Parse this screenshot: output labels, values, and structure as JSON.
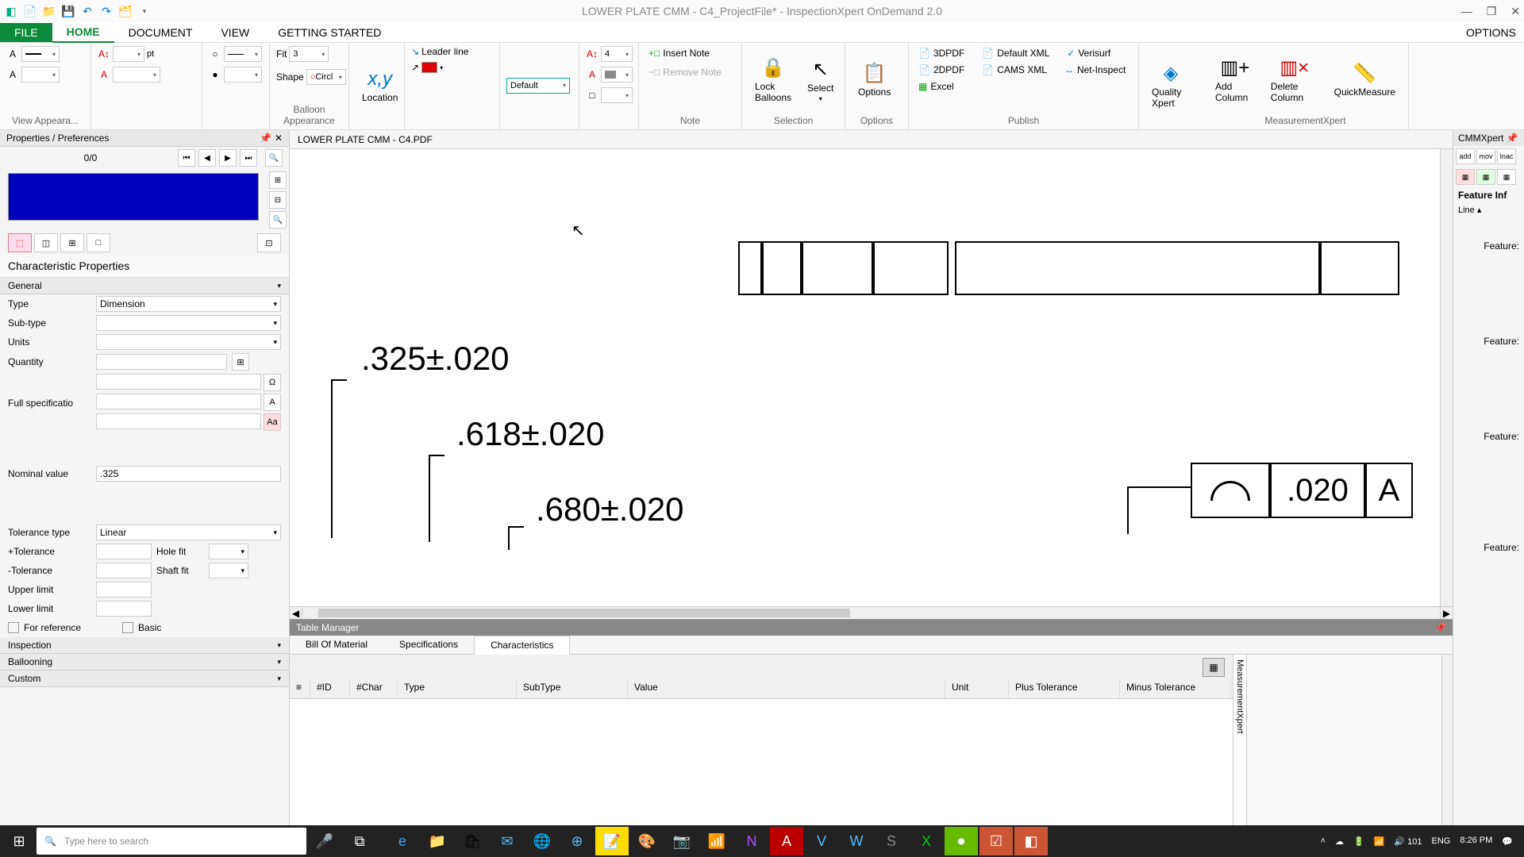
{
  "titlebar": {
    "title": "LOWER PLATE CMM - C4_ProjectFile* - InspectionXpert OnDemand 2.0"
  },
  "menu": {
    "file": "FILE",
    "home": "HOME",
    "document": "DOCUMENT",
    "view": "VIEW",
    "getting_started": "GETTING STARTED",
    "options": "OPTIONS"
  },
  "ribbon": {
    "view_appearance": "View Appeara...",
    "pt": "pt",
    "fit_label": "Fit",
    "shape_label": "Shape",
    "fit_value": "3",
    "shape_value": "Circl",
    "location": "Location",
    "balloon_appearance": "Balloon Appearance",
    "leader_line": "Leader line",
    "default": "Default",
    "note_size": "4",
    "insert_note": "Insert Note",
    "remove_note": "Remove Note",
    "note": "Note",
    "lock_balloons": "Lock Balloons",
    "select": "Select",
    "selection": "Selection",
    "options": "Options",
    "options_group": "Options",
    "pdf3d": "3DPDF",
    "pdf2d": "2DPDF",
    "excel": "Excel",
    "default_xml": "Default XML",
    "cams_xml": "CAMS XML",
    "verisurf": "Verisurf",
    "net_inspect": "Net-Inspect",
    "quality_xpert": "Quality Xpert",
    "publish": "Publish",
    "add_column": "Add Column",
    "delete_column": "Delete Column",
    "quick_measure": "QuickMeasure",
    "measurement_xpert": "MeasurementXpert"
  },
  "left_panel": {
    "title": "Properties / Preferences",
    "counter": "0/0",
    "char_props": "Characteristic Properties",
    "general": "General",
    "type": "Type",
    "type_value": "Dimension",
    "subtype": "Sub-type",
    "units": "Units",
    "quantity": "Quantity",
    "full_spec": "Full specificatio",
    "nominal": "Nominal value",
    "nominal_value": ".325",
    "tol_type": "Tolerance type",
    "tol_type_value": "Linear",
    "plus_tol": "+Tolerance",
    "minus_tol": "-Tolerance",
    "hole_fit": "Hole fit",
    "shaft_fit": "Shaft fit",
    "upper_limit": "Upper limit",
    "lower_limit": "Lower limit",
    "for_reference": "For reference",
    "basic": "Basic",
    "inspection": "Inspection",
    "ballooning": "Ballooning",
    "custom": "Custom"
  },
  "document": {
    "tab": "LOWER PLATE CMM - C4.PDF",
    "dims": {
      "d1": ".325±.020",
      "d2": ".618±.020",
      "d3": ".680±.020",
      "fcf_val": ".020",
      "fcf_datum": "A"
    }
  },
  "table_manager": {
    "title": "Table Manager",
    "tabs": {
      "bom": "Bill Of Material",
      "spec": "Specifications",
      "char": "Characteristics"
    },
    "cols": {
      "id": "#ID",
      "char": "#Char",
      "type": "Type",
      "subtype": "SubType",
      "value": "Value",
      "unit": "Unit",
      "plus": "Plus Tolerance",
      "minus": "Minus Tolerance"
    },
    "side_label": "MeasurementXpert"
  },
  "right_panel": {
    "title": "CMMXpert",
    "tb": {
      "add": "add",
      "mov": "mov",
      "inac": "Inac"
    },
    "feature_info": "Feature Inf",
    "line": "Line",
    "feature": "Feature:"
  },
  "taskbar": {
    "search_placeholder": "Type here to search",
    "lang": "ENG",
    "time": "8:26 PM",
    "sound": "101"
  }
}
